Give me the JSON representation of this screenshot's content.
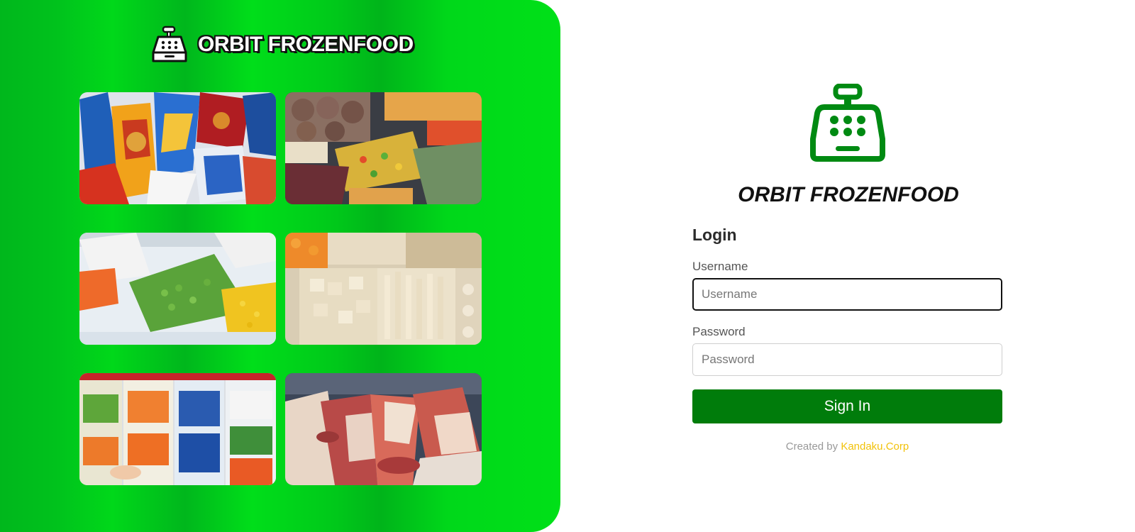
{
  "brand": {
    "name": "ORBIT FROZENFOOD",
    "logo_icon": "cash-register-icon"
  },
  "gallery": [
    {
      "name": "frozen-snack-packages-photo"
    },
    {
      "name": "vacuum-packed-meat-and-vegetables-photo"
    },
    {
      "name": "frozen-peas-and-corn-bags-photo"
    },
    {
      "name": "frozen-fish-balls-and-tofu-photo"
    },
    {
      "name": "frozen-vegetable-freezer-aisle-photo"
    },
    {
      "name": "packaged-sausages-and-salami-photo"
    }
  ],
  "login": {
    "app_title": "ORBIT FROZENFOOD",
    "heading": "Login",
    "username_label": "Username",
    "username_placeholder": "Username",
    "username_value": "",
    "password_label": "Password",
    "password_placeholder": "Password",
    "password_value": "",
    "submit_label": "Sign In"
  },
  "footer": {
    "prefix": "Created by ",
    "link_text": "Kandaku.Corp"
  },
  "colors": {
    "brand_green": "#00d41a",
    "button_green": "#007c0b",
    "icon_green": "#008a12",
    "link_yellow": "#f2c20a"
  }
}
